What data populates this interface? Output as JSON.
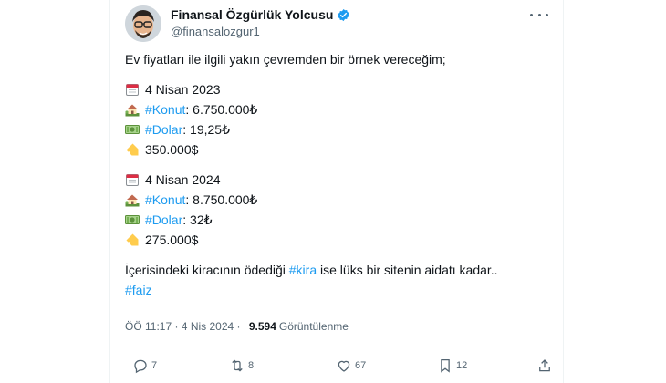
{
  "author": {
    "display_name": "Finansal Özgürlük Yolcusu",
    "handle": "@finansalozgur1",
    "avatar_icon": "avatar-memoji",
    "verified_color": "#1d9bf0"
  },
  "tweet": {
    "intro": "Ev fiyatları ile ilgili yakın çevremden bir örnek vereceğim;",
    "blocks": [
      {
        "date": "4 Nisan 2023",
        "konut_tag": "#Konut",
        "konut_value": ": 6.750.000₺",
        "dolar_tag": "#Dolar",
        "dolar_value": ": 19,25₺",
        "usd_value": "350.000$"
      },
      {
        "date": "4 Nisan 2024",
        "konut_tag": "#Konut",
        "konut_value": ": 8.750.000₺",
        "dolar_tag": "#Dolar",
        "dolar_value": ": 32₺",
        "usd_value": "275.000$"
      }
    ],
    "closing_before": "İçerisindeki kiracının ödediği ",
    "closing_tag": "#kira",
    "closing_after": " ise lüks bir sitenin aidatı kadar..",
    "final_tag": "#faiz"
  },
  "meta": {
    "timestamp": "ÖÖ 11:17 · 4 Nis 2024 · ",
    "views_count": "9.594",
    "views_label": "Görüntülenme"
  },
  "actions": {
    "reply_count": "7",
    "retweet_count": "8",
    "like_count": "67",
    "bookmark_count": "12"
  },
  "colors": {
    "link": "#1d9bf0",
    "muted": "#536471",
    "text": "#0f1419"
  }
}
